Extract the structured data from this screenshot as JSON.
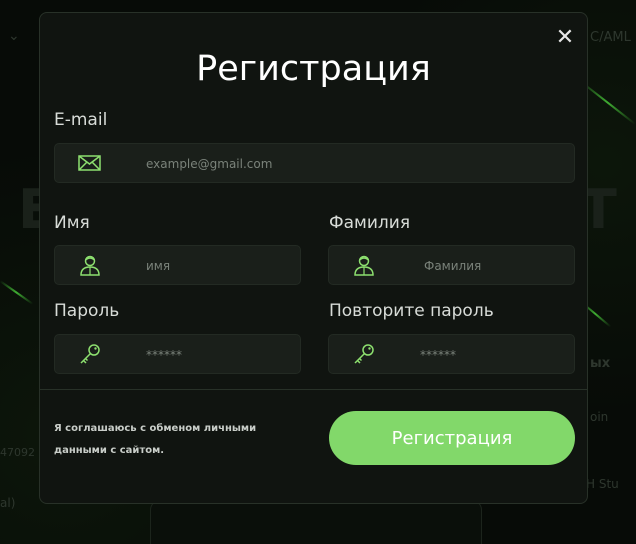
{
  "background": {
    "chevron": "⌄",
    "nav_right": "C/AML",
    "big_left": "E",
    "big_right": "T",
    "right_1": "ых",
    "right_2": "oin",
    "right_3": "H Stu",
    "left_1": "47092",
    "left_2": "al)"
  },
  "modal": {
    "title": "Регистрация",
    "close_symbol": "✕",
    "email": {
      "label": "E-mail",
      "placeholder": "example@gmail.com",
      "icon": "envelope-icon"
    },
    "first_name": {
      "label": "Имя",
      "placeholder": "имя",
      "icon": "user-icon"
    },
    "last_name": {
      "label": "Фамилия",
      "placeholder": "Фамилия",
      "icon": "user-icon"
    },
    "password": {
      "label": "Пароль",
      "placeholder": "******",
      "icon": "key-icon"
    },
    "password_repeat": {
      "label": "Повторите пароль",
      "placeholder": "******",
      "icon": "key-icon"
    },
    "consent_line1": "Я соглашаюсь с обменом личными",
    "consent_line2": "данными с сайтом.",
    "submit_label": "Регистрация"
  },
  "colors": {
    "accent": "#82d86a",
    "icon": "#8de06f",
    "modal_bg": "#101410",
    "field_bg": "#1a1f1a"
  }
}
